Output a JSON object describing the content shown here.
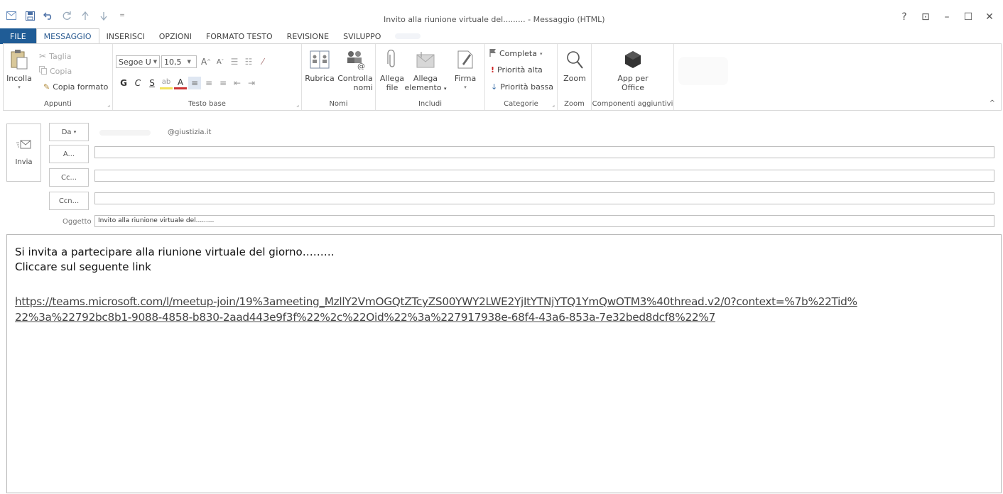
{
  "window": {
    "title": "Invito alla riunione virtuale del......... - Messaggio (HTML)",
    "controls": {
      "help": "?",
      "ribbon_display": "⊡",
      "minimize": "–",
      "maximize": "☐",
      "close": "✕"
    }
  },
  "qat": {
    "icons": [
      "outlook-icon",
      "save-icon",
      "undo-icon",
      "redo-icon",
      "up-icon",
      "down-icon",
      "customize-icon"
    ]
  },
  "tabs": [
    {
      "label": "FILE"
    },
    {
      "label": "MESSAGGIO"
    },
    {
      "label": "INSERISCI"
    },
    {
      "label": "OPZIONI"
    },
    {
      "label": "FORMATO TESTO"
    },
    {
      "label": "REVISIONE"
    },
    {
      "label": "SVILUPPO"
    }
  ],
  "ribbon": {
    "appunti": {
      "label": "Appunti",
      "paste": "Incolla",
      "cut": "Taglia",
      "copy": "Copia",
      "format_painter": "Copia formato"
    },
    "testo_base": {
      "label": "Testo base",
      "font": "Segoe U",
      "size": "10,5",
      "bold": "G",
      "italic": "C",
      "underline": "S"
    },
    "nomi": {
      "label": "Nomi",
      "address_book": "Rubrica",
      "check_names_1": "Controlla",
      "check_names_2": "nomi"
    },
    "includi": {
      "label": "Includi",
      "attach_file_1": "Allega",
      "attach_file_2": "file",
      "attach_item_1": "Allega",
      "attach_item_2": "elemento",
      "signature": "Firma"
    },
    "categorie": {
      "label": "Categorie",
      "follow_up": "Completa",
      "high_priority": "Priorità alta",
      "low_priority": "Priorità bassa"
    },
    "zoom": {
      "label": "Zoom",
      "button": "Zoom"
    },
    "componenti": {
      "label": "Componenti aggiuntivi",
      "apps_1": "App per",
      "apps_2": "Office"
    }
  },
  "compose": {
    "send": "Invia",
    "from_button": "Da",
    "from_domain": "@giustizia.it",
    "to_button": "A...",
    "cc_button": "Cc...",
    "bcc_button": "Ccn...",
    "to_value": "",
    "cc_value": "",
    "bcc_value": "",
    "subject_label": "Oggetto",
    "subject_value": "Invito alla riunione virtuale del........."
  },
  "body": {
    "line1": "Si invita a partecipare alla riunione virtuale del giorno………",
    "line2": "Cliccare sul seguente link",
    "link_line1": "https://teams.microsoft.com/l/meetup-join/19%3ameeting_MzllY2VmOGQtZTcyZS00YWY2LWE2YjItYTNjYTQ1YmQwOTM3%40thread.v2/0?context=%7b%22Tid%",
    "link_line2": "22%3a%22792bc8b1-9088-4858-b830-2aad443e9f3f%22%2c%22Oid%22%3a%227917938e-68f4-43a6-853a-7e32bed8dcf8%22%7"
  },
  "colors": {
    "file_tab": "#1f5c96",
    "link": "#444444",
    "accent": "#2c5c92"
  }
}
